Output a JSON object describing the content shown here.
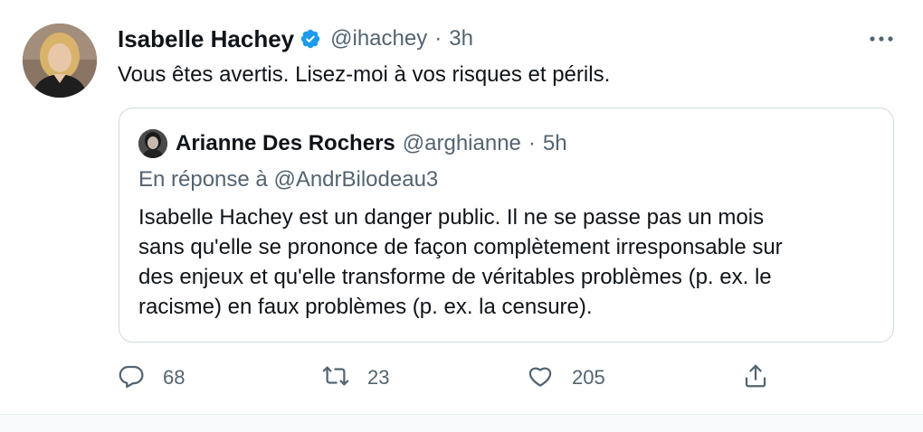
{
  "tweet": {
    "author_name": "Isabelle Hachey",
    "handle": "@ihachey",
    "separator": "·",
    "time": "3h",
    "text": "Vous êtes avertis. Lisez-moi à vos risques et périls."
  },
  "quoted": {
    "author_name": "Arianne Des Rochers",
    "handle": "@arghianne",
    "separator": "·",
    "time": "5h",
    "reply_prefix": "En réponse à",
    "reply_mention": "@AndrBilodeau3",
    "body_lines": [
      "Isabelle Hachey est un danger public. Il ne se passe pas un mois",
      "sans qu'elle se prononce de façon complètement irresponsable sur",
      "des enjeux et qu'elle transforme de véritables problèmes (p. ex. le",
      "racisme) en faux problèmes (p. ex. la censure)."
    ]
  },
  "actions": {
    "reply_count": "68",
    "retweet_count": "23",
    "like_count": "205"
  },
  "icons": {
    "verified": "verified-badge-icon",
    "more": "more-dots-icon",
    "reply": "reply-icon",
    "retweet": "retweet-icon",
    "like": "heart-icon",
    "share": "share-icon"
  },
  "colors": {
    "verified_blue": "#1d9bf0",
    "text": "#0f1419",
    "secondary": "#536471",
    "border": "#cfd9de"
  }
}
